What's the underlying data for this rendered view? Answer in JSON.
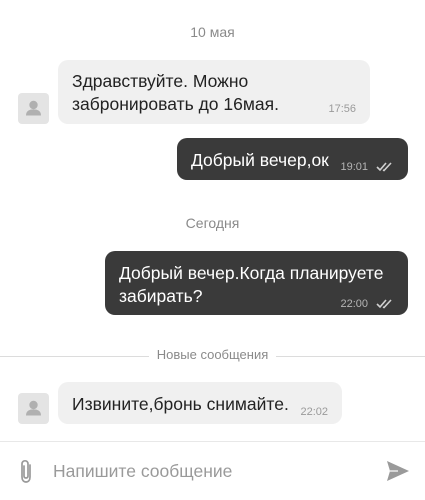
{
  "chat": {
    "date_separator_1": "10 мая",
    "date_separator_2": "Сегодня",
    "new_messages_label": "Новые сообщения",
    "messages": [
      {
        "direction": "incoming",
        "line1": "Здравствуйте. Можно",
        "line2": "забронировать до 16мая.",
        "time": "17:56"
      },
      {
        "direction": "outgoing",
        "text": "Добрый вечер,ок",
        "time": "19:01",
        "status": "read-double-check"
      },
      {
        "direction": "outgoing",
        "line1": "Добрый вечер.Когда планируете",
        "line2": "забирать?",
        "time": "22:00",
        "status": "read-double-check"
      },
      {
        "direction": "incoming",
        "text": "Извините,бронь снимайте.",
        "time": "22:02"
      }
    ]
  },
  "composer": {
    "placeholder": "Напишите сообщение",
    "attach_icon": "paperclip-icon",
    "send_icon": "send-icon"
  },
  "colors": {
    "incoming_bubble": "#f0f0f0",
    "outgoing_bubble": "#3a3a3a",
    "muted_text": "#8a8a8a"
  }
}
